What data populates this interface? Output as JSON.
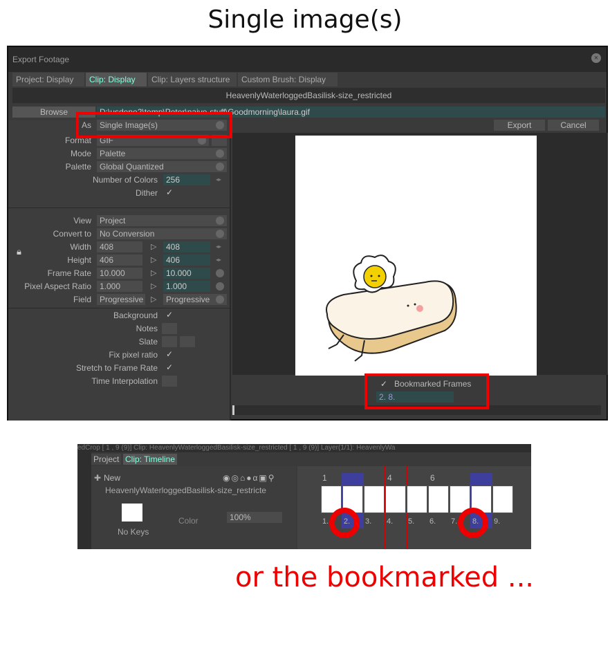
{
  "heading": "Single image(s)",
  "caption": "or the bookmarked ...",
  "dialog": {
    "title": "Export Footage",
    "tabs": [
      "Project: Display",
      "Clip: Display",
      "Clip: Layers structure",
      "Custom Brush: Display"
    ],
    "active_tab": "Clip: Display",
    "clip_name": "HeavenlyWaterloggedBasilisk-size_restricted",
    "browse_label": "Browse",
    "path_value": "D:\\usdene2\\temp\\Peter\\naive-stuff\\Goodmorning\\laura.gif",
    "export_label": "Export",
    "cancel_label": "Cancel",
    "as_label": "As",
    "as_value": "Single Image(s)",
    "format_label": "Format",
    "format_value": "GIF",
    "mode_label": "Mode",
    "mode_value": "Palette",
    "palette_label": "Palette",
    "palette_value": "Global Quantized",
    "num_colors_label": "Number of Colors",
    "num_colors_value": "256",
    "dither_label": "Dither",
    "view_label": "View",
    "view_value": "Project",
    "convert_label": "Convert to",
    "convert_value": "No Conversion",
    "width_label": "Width",
    "width_src": "408",
    "width_dst": "408",
    "height_label": "Height",
    "height_src": "406",
    "height_dst": "406",
    "framerate_label": "Frame Rate",
    "framerate_src": "10.000",
    "framerate_dst": "10.000",
    "par_label": "Pixel Aspect Ratio",
    "par_src": "1.000",
    "par_dst": "1.000",
    "field_label": "Field",
    "field_src": "Progressive",
    "field_dst": "Progressive",
    "background_label": "Background",
    "notes_label": "Notes",
    "slate_label": "Slate",
    "fixpixel_label": "Fix pixel ratio",
    "stretch_label": "Stretch to Frame Rate",
    "timeinterp_label": "Time Interpolation",
    "bookmarked_label": "Bookmarked Frames",
    "bookmarked_value": "2. 8.",
    "checkmark": "✓"
  },
  "timeline": {
    "top_strip": "edCrop [ 1 , 9 (9)]        Clip: HeavenlyWaterloggedBasilisk-size_restricted [ 1 , 9 (9)]        Layer(1/1): HeavenlyWa",
    "tabs": [
      "Project",
      "Clip: Timeline"
    ],
    "new_label": "New",
    "layer_name": "HeavenlyWaterloggedBasilisk-size_restricte",
    "color_label": "Color",
    "opacity_value": "100%",
    "nokeys_label": "No Keys",
    "ruler": [
      "1",
      "4",
      "6"
    ],
    "frame_numbers": [
      "1.",
      "2.",
      "3.",
      "4.",
      "5.",
      "6.",
      "7.",
      "8.",
      "9."
    ],
    "bookmark_color": "#3b3bd8"
  },
  "colors": {
    "highlight": "#e00000",
    "accent_field": "#2f4a4a"
  }
}
